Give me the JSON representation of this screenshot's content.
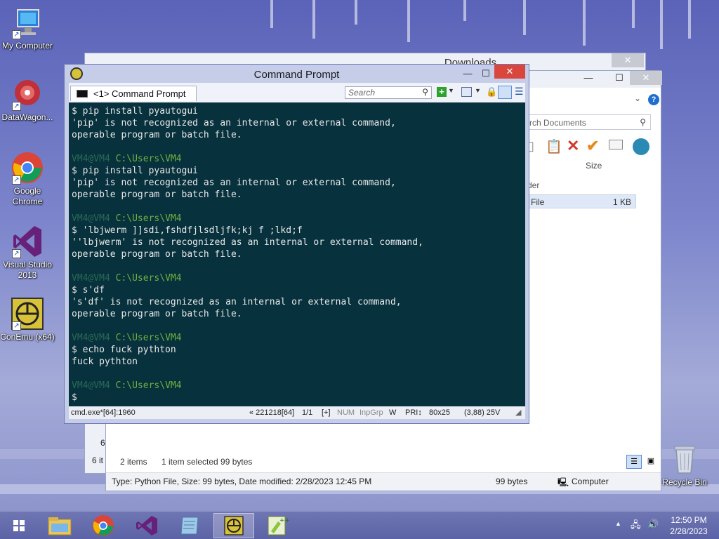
{
  "desktop": {
    "icons": [
      {
        "label": "My Computer",
        "icon": "computer-icon"
      },
      {
        "label": "DataWagon...",
        "icon": "datawagon-icon"
      },
      {
        "label": "Google Chrome",
        "icon": "chrome-icon"
      },
      {
        "label": "Visual Studio 2013",
        "icon": "visual-studio-icon"
      },
      {
        "label": "ConEmu (x64)",
        "icon": "conemu-icon"
      },
      {
        "label": "Recycle Bin",
        "icon": "recycle-bin-icon"
      }
    ]
  },
  "explorer_back": {
    "title": "Downloads",
    "status_left_items": "6 it",
    "side_text": "6"
  },
  "explorer": {
    "search_placeholder": "rch Documents",
    "column_size": "Size",
    "group_label": "der",
    "file_type": "File",
    "file_size": "1 KB",
    "status_items": "2 items",
    "status_selected": "1 item selected  99 bytes",
    "details_text": "Type: Python File, Size: 99 bytes, Date modified: 2/28/2023 12:45 PM",
    "details_size": "99 bytes",
    "details_location": "Computer"
  },
  "cmd": {
    "title": "Command Prompt",
    "tab_label": "<1> Command Prompt",
    "search_placeholder": "Search",
    "lines": [
      {
        "type": "out",
        "text": "$ pip install pyautogui"
      },
      {
        "type": "out",
        "text": "'pip' is not recognized as an internal or external command,"
      },
      {
        "type": "out",
        "text": "operable program or batch file."
      },
      {
        "type": "blank",
        "text": ""
      },
      {
        "type": "prompt",
        "user": "VM4@VM4",
        "path": " C:\\Users\\VM4"
      },
      {
        "type": "out",
        "text": "$ pip install pyautogui"
      },
      {
        "type": "out",
        "text": "'pip' is not recognized as an internal or external command,"
      },
      {
        "type": "out",
        "text": "operable program or batch file."
      },
      {
        "type": "blank",
        "text": ""
      },
      {
        "type": "prompt",
        "user": "VM4@VM4",
        "path": " C:\\Users\\VM4"
      },
      {
        "type": "out",
        "text": "$ 'lbjwerm ]]sdi,fshdfjlsdljfk;kj f ;lkd;f"
      },
      {
        "type": "out",
        "text": "''lbjwerm' is not recognized as an internal or external command,"
      },
      {
        "type": "out",
        "text": "operable program or batch file."
      },
      {
        "type": "blank",
        "text": ""
      },
      {
        "type": "prompt",
        "user": "VM4@VM4",
        "path": " C:\\Users\\VM4"
      },
      {
        "type": "out",
        "text": "$ s'df"
      },
      {
        "type": "out",
        "text": "'s'df' is not recognized as an internal or external command,"
      },
      {
        "type": "out",
        "text": "operable program or batch file."
      },
      {
        "type": "blank",
        "text": ""
      },
      {
        "type": "prompt",
        "user": "VM4@VM4",
        "path": " C:\\Users\\VM4"
      },
      {
        "type": "out",
        "text": "$ echo fuck pythton"
      },
      {
        "type": "out",
        "text": "fuck pythton"
      },
      {
        "type": "blank",
        "text": ""
      },
      {
        "type": "prompt",
        "user": "VM4@VM4",
        "path": " C:\\Users\\VM4"
      },
      {
        "type": "out",
        "text": "$"
      }
    ],
    "status": {
      "process": "cmd.exe*[64]:1960",
      "pid": "« 221218[64]",
      "pages": "1/1",
      "plus": "[+]",
      "num": "NUM",
      "inpgrp": "InpGrp",
      "w": "W",
      "pri": "PRI↕",
      "size": "80x25",
      "cursor": "(3,88) 25V"
    }
  },
  "taskbar": {
    "buttons": [
      "start-button",
      "file-explorer-button",
      "chrome-button",
      "visual-studio-button",
      "notepad-button",
      "conemu-button",
      "notepad-plus-button"
    ],
    "time": "12:50 PM",
    "date": "2/28/2023"
  }
}
